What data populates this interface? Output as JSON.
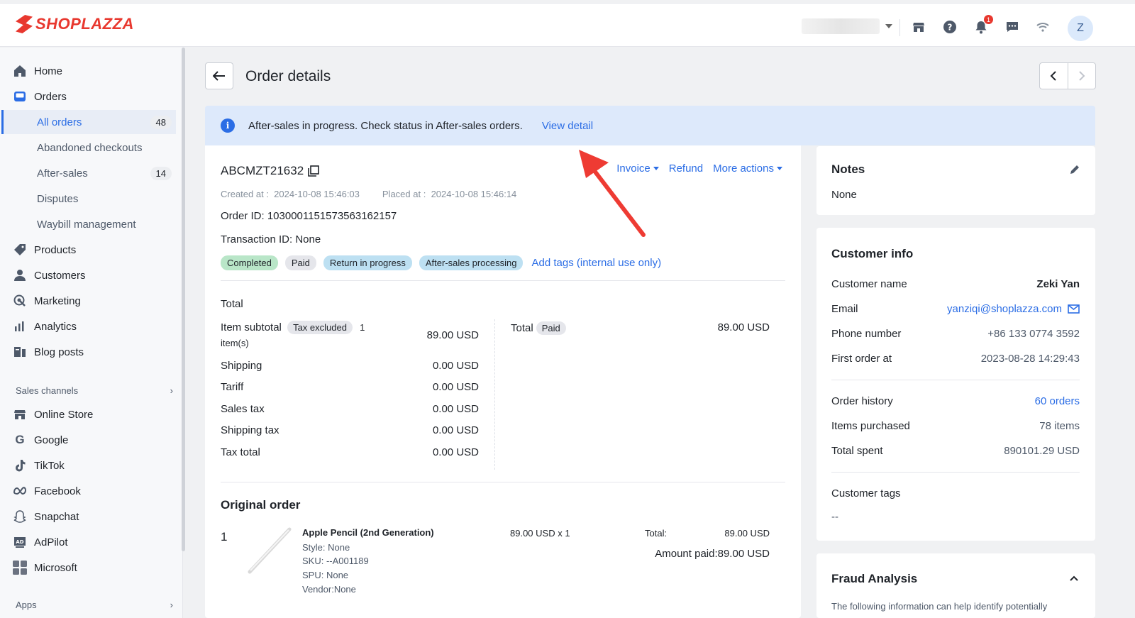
{
  "brand": {
    "logo_text": "SHOPLAZZA",
    "accent": "#e8382f",
    "link_color": "#2b6de5"
  },
  "topbar": {
    "notification_count": "1",
    "avatar_initial": "Z",
    "icons": [
      "store-icon",
      "help-icon",
      "bell-icon",
      "chat-icon",
      "wifi-icon"
    ]
  },
  "sidebar": {
    "home": "Home",
    "orders": "Orders",
    "all_orders": "All orders",
    "all_orders_count": "48",
    "abandoned": "Abandoned checkouts",
    "after_sales": "After-sales",
    "after_sales_count": "14",
    "disputes": "Disputes",
    "waybill": "Waybill management",
    "products": "Products",
    "customers": "Customers",
    "marketing": "Marketing",
    "analytics": "Analytics",
    "blog": "Blog posts",
    "sales_channels": "Sales channels",
    "online_store": "Online Store",
    "google": "Google",
    "tiktok": "TikTok",
    "facebook": "Facebook",
    "snapchat": "Snapchat",
    "adpilot": "AdPilot",
    "microsoft": "Microsoft",
    "apps": "Apps"
  },
  "page": {
    "title": "Order details"
  },
  "banner": {
    "message": "After-sales in progress. Check status in After-sales orders.",
    "link": "View detail"
  },
  "order": {
    "number": "ABCMZT21632",
    "actions": {
      "invoice": "Invoice",
      "refund": "Refund",
      "more": "More actions"
    },
    "created_label": "Created at :",
    "created_value": "2024-10-08 15:46:03",
    "placed_label": "Placed at :",
    "placed_value": "2024-10-08 15:46:14",
    "order_id": "Order ID: 1030001151573563162157",
    "transaction_id": "Transaction ID: None",
    "tags": [
      "Completed",
      "Paid",
      "Return in progress",
      "After-sales processing"
    ],
    "add_tags": "Add tags (internal use only)"
  },
  "totals": {
    "title": "Total",
    "item_subtotal_label": "Item subtotal",
    "tax_excluded": "Tax excluded",
    "item_count": "1",
    "items_unit": "item(s)",
    "item_subtotal": "89.00 USD",
    "rows": [
      {
        "label": "Shipping",
        "value": "0.00 USD"
      },
      {
        "label": "Tariff",
        "value": "0.00 USD"
      },
      {
        "label": "Sales tax",
        "value": "0.00 USD"
      },
      {
        "label": "Shipping tax",
        "value": "0.00 USD"
      },
      {
        "label": "Tax total",
        "value": "0.00 USD"
      }
    ],
    "total_label": "Total",
    "total_status": "Paid",
    "total_value": "89.00 USD"
  },
  "original_order": {
    "title": "Original order",
    "index": "1",
    "product_name": "Apple Pencil (2nd Generation)",
    "style": "Style: None",
    "sku": "SKU: --A001189",
    "spu": "SPU: None",
    "vendor": "Vendor:None",
    "price_qty": "89.00 USD x 1",
    "total_label": "Total:",
    "total_value": "89.00 USD",
    "amount_paid": "Amount paid:89.00 USD"
  },
  "notes": {
    "title": "Notes",
    "value": "None"
  },
  "customer": {
    "title": "Customer info",
    "name_label": "Customer name",
    "name": "Zeki Yan",
    "email_label": "Email",
    "email": "yanziqi@shoplazza.com",
    "phone_label": "Phone number",
    "phone": "+86 133 0774 3592",
    "first_order_label": "First order at",
    "first_order": "2023-08-28 14:29:43",
    "history_label": "Order history",
    "history": "60 orders",
    "items_label": "Items purchased",
    "items": "78 items",
    "spent_label": "Total spent",
    "spent": "890101.29 USD",
    "tags_label": "Customer tags",
    "tags": "--"
  },
  "fraud": {
    "title": "Fraud Analysis",
    "desc": "The following information can help identify potentially"
  }
}
